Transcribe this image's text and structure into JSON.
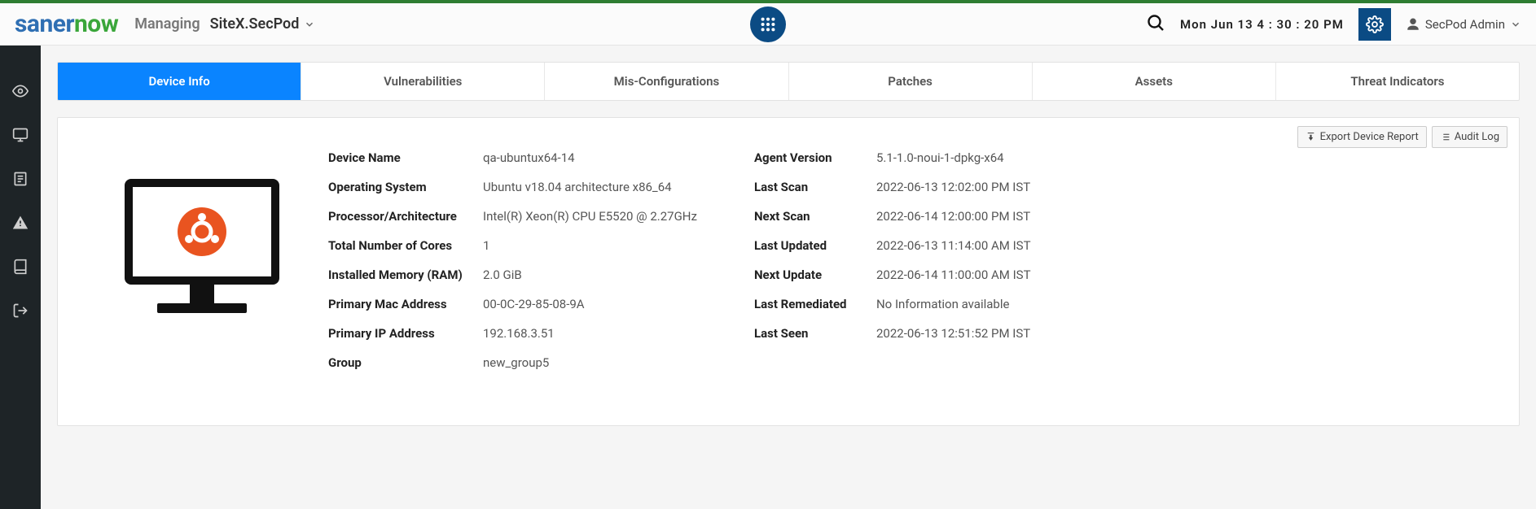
{
  "brand": {
    "part1": "saner",
    "part2": "now"
  },
  "header": {
    "managing_label": "Managing",
    "site": "SiteX.SecPod",
    "datetime": "Mon Jun 13  4 : 30 : 20 PM",
    "user": "SecPod Admin"
  },
  "tabs": [
    {
      "label": "Device Info",
      "active": true
    },
    {
      "label": "Vulnerabilities",
      "active": false
    },
    {
      "label": "Mis-Configurations",
      "active": false
    },
    {
      "label": "Patches",
      "active": false
    },
    {
      "label": "Assets",
      "active": false
    },
    {
      "label": "Threat Indicators",
      "active": false
    }
  ],
  "actions": {
    "export": "Export Device Report",
    "audit": "Audit Log"
  },
  "device": {
    "left": [
      {
        "k": "Device Name",
        "v": "qa-ubuntux64-14"
      },
      {
        "k": "Operating System",
        "v": "Ubuntu v18.04 architecture x86_64"
      },
      {
        "k": "Processor/Architecture",
        "v": "Intel(R) Xeon(R) CPU E5520 @ 2.27GHz"
      },
      {
        "k": "Total Number of Cores",
        "v": "1"
      },
      {
        "k": "Installed Memory (RAM)",
        "v": "2.0 GiB"
      },
      {
        "k": "Primary Mac Address",
        "v": "00-0C-29-85-08-9A"
      },
      {
        "k": "Primary IP Address",
        "v": "192.168.3.51"
      },
      {
        "k": "Group",
        "v": "new_group5"
      }
    ],
    "right": [
      {
        "k": "Agent Version",
        "v": "5.1-1.0-noui-1-dpkg-x64"
      },
      {
        "k": "Last Scan",
        "v": "2022-06-13 12:02:00 PM IST"
      },
      {
        "k": "Next Scan",
        "v": "2022-06-14 12:00:00 PM IST"
      },
      {
        "k": "Last Updated",
        "v": "2022-06-13 11:14:00 AM IST"
      },
      {
        "k": "Next Update",
        "v": "2022-06-14 11:00:00 AM IST"
      },
      {
        "k": "Last Remediated",
        "v": "No Information available"
      },
      {
        "k": "Last Seen",
        "v": "2022-06-13 12:51:52 PM IST"
      }
    ]
  }
}
